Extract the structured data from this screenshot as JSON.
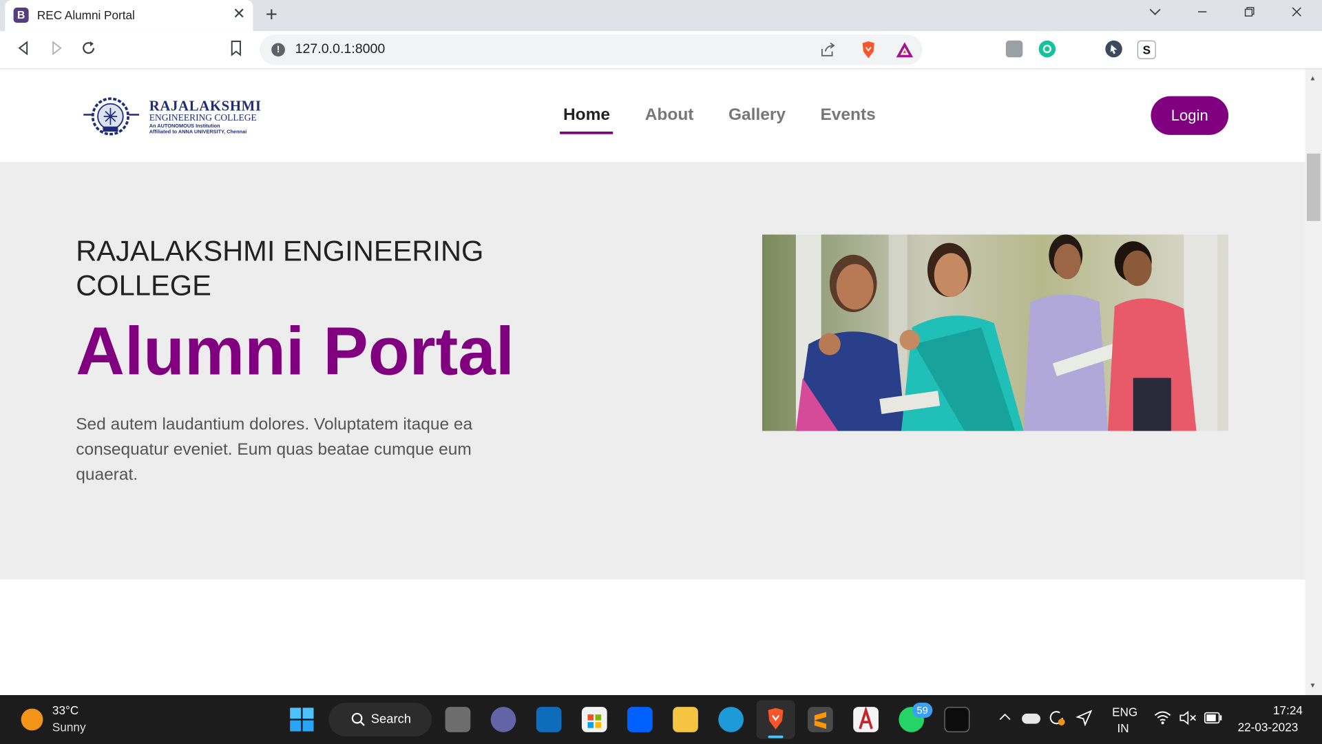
{
  "browser": {
    "tab_title": "REC Alumni Portal",
    "tab_favicon_letter": "B",
    "new_tab_glyph": "+",
    "close_glyph": "✕",
    "url": "127.0.0.1:8000",
    "window_controls": [
      "chevron-down-icon",
      "minimize-icon",
      "restore-icon",
      "close-icon"
    ],
    "extensions": [
      "brave-shields-icon",
      "brave-rewards-icon",
      "grammarly-icon",
      "eyedropper-icon",
      "cursor-icon",
      "s-extension-icon",
      "puzzle-icon",
      "sidebar-icon",
      "wallet-icon",
      "menu-icon"
    ]
  },
  "site": {
    "logo": {
      "line1": "RAJALAKSHMI",
      "line2": "ENGINEERING COLLEGE",
      "line3": "An AUTONOMOUS Institution",
      "line4": "Affiliated to ANNA UNIVERSITY, Chennai"
    },
    "nav": [
      {
        "label": "Home",
        "active": true
      },
      {
        "label": "About",
        "active": false
      },
      {
        "label": "Gallery",
        "active": false
      },
      {
        "label": "Events",
        "active": false
      }
    ],
    "login_label": "Login",
    "accent_color": "#800080"
  },
  "hero": {
    "college": "RAJALAKSHMI ENGINEERING COLLEGE",
    "title": "Alumni Portal",
    "description": "Sed autem laudantium dolores. Voluptatem itaque ea consequatur eveniet. Eum quas beatae cumque eum quaerat."
  },
  "taskbar": {
    "weather_temp": "33°C",
    "weather_desc": "Sunny",
    "search_label": "Search",
    "whatsapp_badge": "59",
    "lang_line1": "ENG",
    "lang_line2": "IN",
    "time": "17:24",
    "date": "22-03-2023"
  }
}
